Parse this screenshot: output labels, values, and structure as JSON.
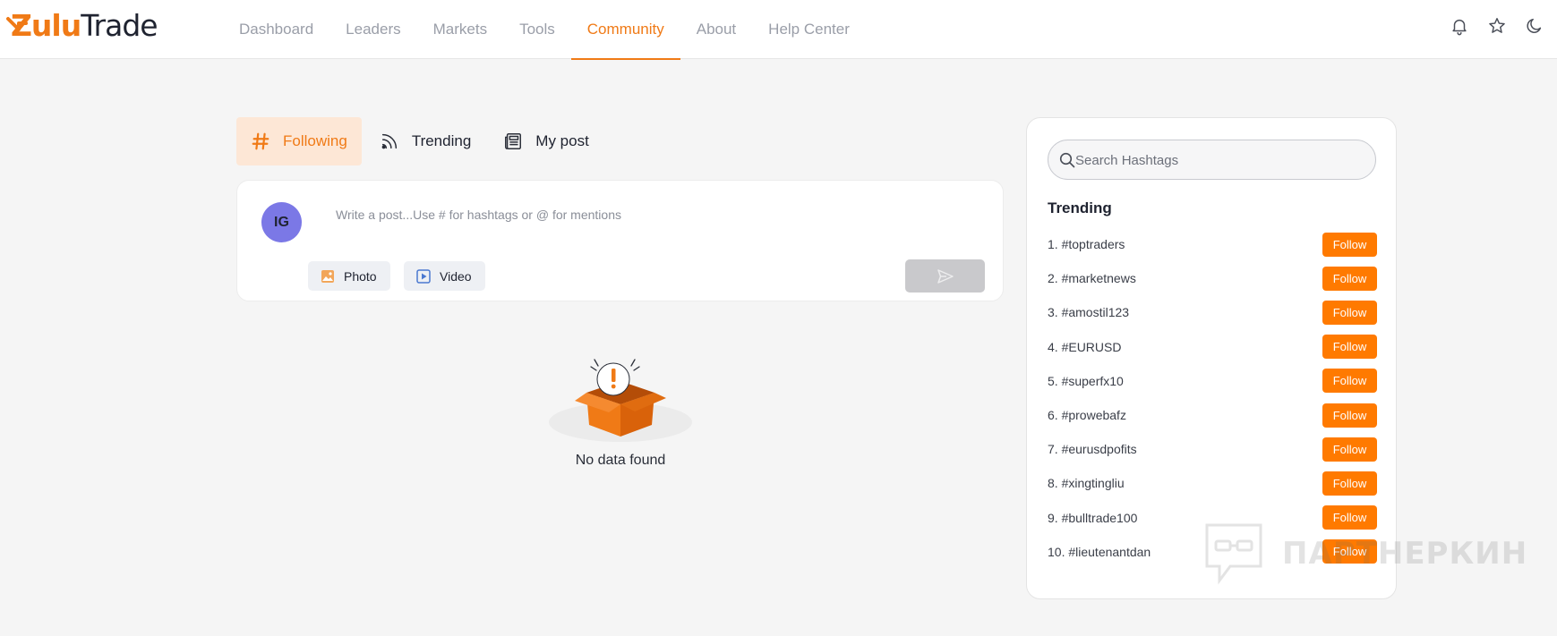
{
  "brand": {
    "logo_zulu": "Zulu",
    "logo_trade": "Trade",
    "accent": "#f07a16"
  },
  "nav": {
    "items": [
      {
        "label": "Dashboard",
        "active": false
      },
      {
        "label": "Leaders",
        "active": false
      },
      {
        "label": "Markets",
        "active": false
      },
      {
        "label": "Tools",
        "active": false
      },
      {
        "label": "Community",
        "active": true
      },
      {
        "label": "About",
        "active": false
      },
      {
        "label": "Help Center",
        "active": false
      }
    ]
  },
  "header_icons": [
    "bell-icon",
    "star-icon",
    "moon-icon"
  ],
  "tabs": [
    {
      "label": "Following",
      "icon": "hashtag-icon",
      "active": true
    },
    {
      "label": "Trending",
      "icon": "rss-icon",
      "active": false
    },
    {
      "label": "My post",
      "icon": "newspaper-icon",
      "active": false
    }
  ],
  "composer": {
    "avatar_initials": "IG",
    "placeholder": "Write a post...Use # for hashtags or @ for mentions",
    "photo_label": "Photo",
    "video_label": "Video"
  },
  "empty_state": {
    "text": "No data found"
  },
  "sidebar": {
    "search_placeholder": "Search Hashtags",
    "title": "Trending",
    "follow_label": "Follow",
    "hashtags": [
      "1. #toptraders",
      "2. #marketnews",
      "3. #amostil123",
      "4. #EURUSD",
      "5. #superfx10",
      "6. #prowebafz",
      "7. #eurusdpofits",
      "8. #xingtingliu",
      "9. #bulltrade100",
      "10. #lieutenantdan"
    ]
  },
  "watermark": {
    "text": "ПАРТНЕРКИН"
  }
}
